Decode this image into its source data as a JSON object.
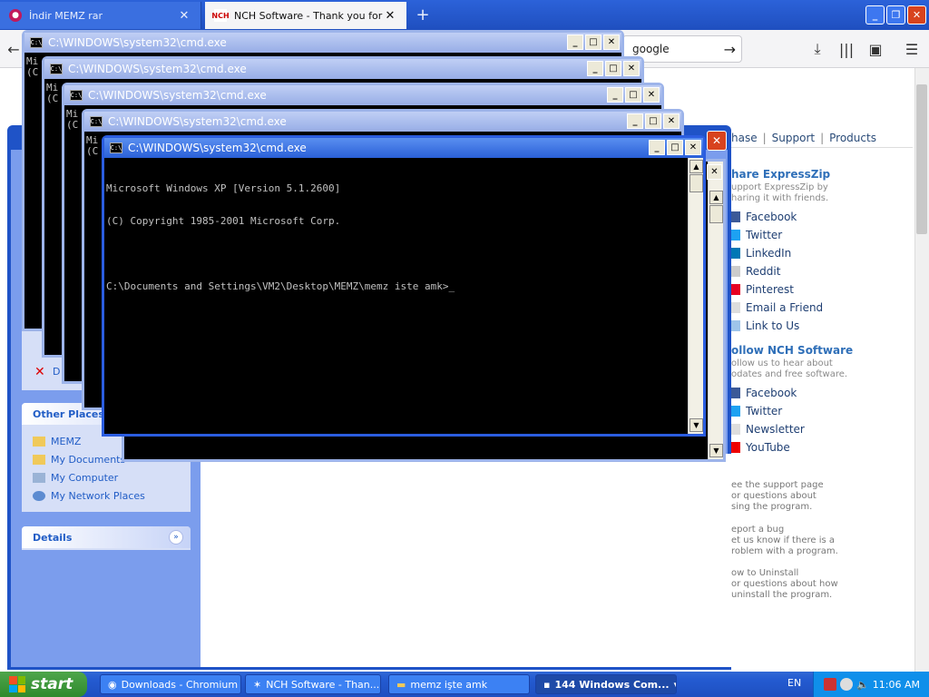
{
  "browser": {
    "tabs": [
      {
        "title": "İndir MEMZ rar",
        "active": false
      },
      {
        "title": "NCH Software - Thank you for Do",
        "active": true
      }
    ],
    "new_tab_label": "+",
    "address_text": "google",
    "window_buttons": [
      "_",
      "❐",
      "✕"
    ]
  },
  "site": {
    "nav": [
      "hase",
      "Support",
      "Products"
    ],
    "share_heading": "hare ExpressZip",
    "share_sub": [
      "upport ExpressZip by",
      "haring it with friends."
    ],
    "share_links": [
      "Facebook",
      "Twitter",
      "LinkedIn",
      "Reddit",
      "Pinterest",
      "Email a Friend",
      "Link to Us"
    ],
    "follow_heading": "ollow NCH Software",
    "follow_sub": [
      "ollow us to hear about",
      "odates and free software."
    ],
    "follow_links": [
      "Facebook",
      "Twitter",
      "Newsletter",
      "YouTube"
    ],
    "help": [
      [
        "ee the support page",
        "or questions about",
        "sing the program."
      ],
      [
        "eport a bug",
        "et us know if there is a",
        "roblem with a program."
      ],
      [
        "ow to Uninstall",
        "or questions about how",
        "uninstall the program."
      ]
    ]
  },
  "explorer": {
    "other_places_title": "Other Places",
    "other_places": [
      "MEMZ",
      "My Documents",
      "My Computer",
      "My Network Places"
    ],
    "details_title": "Details",
    "left_fragment": "D"
  },
  "cmd": {
    "title": "C:\\WINDOWS\\system32\\cmd.exe",
    "lines": [
      "Microsoft Windows XP [Version 5.1.2600]",
      "(C) Copyright 1985-2001 Microsoft Corp.",
      "",
      "C:\\Documents and Settings\\VM2\\Desktop\\MEMZ\\memz iste amk>_"
    ],
    "ghost_fragment_1": "Mi",
    "ghost_fragment_2": "(C"
  },
  "taskbar": {
    "start_label": "start",
    "items": [
      {
        "label": "Downloads - Chromium"
      },
      {
        "label": "NCH Software - Than..."
      },
      {
        "label": "memz işte amk"
      },
      {
        "label": "144 Windows Com...",
        "active": true
      }
    ],
    "language": "EN",
    "time": "11:06 AM"
  },
  "colors": {
    "xp_blue": "#245bd1",
    "start_green": "#3a9a35",
    "close_red": "#d8431e",
    "link_blue": "#215dc6"
  }
}
